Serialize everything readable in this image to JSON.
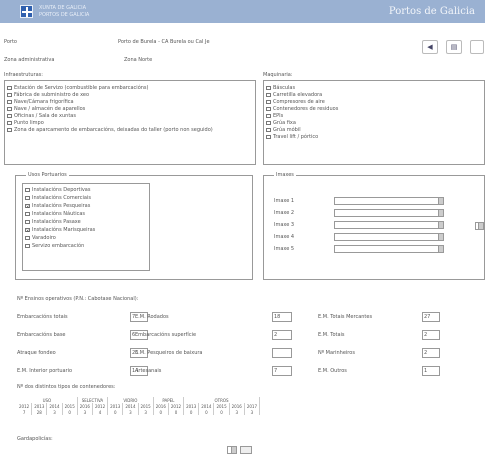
{
  "header": {
    "logo_line1": "XUNTA DE GALICIA",
    "logo_line2": "PORTOS DE GALICIA",
    "title": "Portos de Galicia"
  },
  "info": {
    "porto_label": "Porto",
    "porto_value": "Porto de Burela - CA Burela ou Cal Je",
    "zona_label": "Zona administrativa",
    "zona_value": "Zona Norte"
  },
  "nav": {
    "prev": "◀",
    "print": "▤"
  },
  "infraestruturas": {
    "label": "Infraestruturas:",
    "items": [
      {
        "label": "Estación de Servizo (combustible para embarcacións)",
        "checked": false
      },
      {
        "label": "Fábrica de subministro de xeo",
        "checked": false
      },
      {
        "label": "Nave/Cámara frigorífica",
        "checked": false
      },
      {
        "label": "Nave / almacén de aparellos",
        "checked": false
      },
      {
        "label": "Oficinas / Sala de xuntas",
        "checked": false
      },
      {
        "label": "Punto limpo",
        "checked": false
      },
      {
        "label": "Zona de aparcamento de embarcacións, deixadas do taller (porto non seguido)",
        "checked": false
      }
    ]
  },
  "maquinaria": {
    "label": "Maquinaria:",
    "items": [
      {
        "label": "Básculas",
        "checked": false
      },
      {
        "label": "Carretilla elevadora",
        "checked": false
      },
      {
        "label": "Compresores de aire",
        "checked": false
      },
      {
        "label": "Contenedores de residuos",
        "checked": false
      },
      {
        "label": "EPIs",
        "checked": false
      },
      {
        "label": "Grúa fixa",
        "checked": false
      },
      {
        "label": "Grúa móbil",
        "checked": false
      },
      {
        "label": "Travel lift / pórtico",
        "checked": false
      }
    ]
  },
  "usos": {
    "legend": "Usos Portuarios",
    "items": [
      {
        "label": "Instalacións Deportivas",
        "checked": false
      },
      {
        "label": "Instalacións Comerciais",
        "checked": false
      },
      {
        "label": "Instalacións Pesqueiras",
        "checked": true
      },
      {
        "label": "Instalacións Náuticas",
        "checked": false
      },
      {
        "label": "Instalacións Pasaxe",
        "checked": false
      },
      {
        "label": "Instalacións Marisqueiras",
        "checked": true
      },
      {
        "label": "Varadoiro",
        "checked": false
      },
      {
        "label": "Servizo embarcación",
        "checked": false
      }
    ]
  },
  "imaxes": {
    "legend": "Imaxes",
    "fields": [
      "Imaxe 1",
      "Imaxe 2",
      "Imaxe 3",
      "Imaxe 4",
      "Imaxe 5"
    ]
  },
  "fisicos": {
    "title": "Nº Ensinos operativos (P.N.: Cabotaxe Nacional):",
    "rows": [
      [
        {
          "label": "Embarcacións totais",
          "value": "7"
        },
        {
          "label": "E.M. Rodados",
          "value": "18"
        },
        {
          "label": "E.M. Totais Mercantes",
          "value": "27"
        }
      ],
      [
        {
          "label": "Embarcacións base",
          "value": "6"
        },
        {
          "label": "Embarcacións superfície",
          "value": "2"
        },
        {
          "label": "E.M. Totais",
          "value": "2"
        }
      ],
      [
        {
          "label": "Atraque fondeo",
          "value": "26"
        },
        {
          "label": "E.M. Pesqueiros de baixura",
          "value": ""
        },
        {
          "label": "Nº Marinheiros",
          "value": "2"
        }
      ],
      [
        {
          "label": "E.M. Interior portuario",
          "value": "14"
        },
        {
          "label": "Artesanais",
          "value": "7"
        },
        {
          "label": "E.M. Outros",
          "value": "1"
        }
      ]
    ]
  },
  "stats": {
    "title": "Nº dos distintos tipos de contenedores:",
    "groups": [
      "USO",
      "SELECTIVA",
      "VIDRIO",
      "PAPEL",
      "OTROS"
    ],
    "cols": [
      "2012",
      "2013",
      "2014",
      "2015",
      "2016",
      "2012",
      "2013",
      "2014",
      "2015",
      "2016",
      "2012",
      "2013",
      "2014",
      "2015",
      "2016",
      "2017"
    ],
    "values": [
      "7",
      "28",
      "3",
      "0",
      "3",
      "4",
      "0",
      "3",
      "3",
      "0",
      "0",
      "0",
      "0",
      "0",
      "3",
      "3"
    ]
  },
  "garda": {
    "label": "Gardapolicías:",
    "select_value": ""
  }
}
